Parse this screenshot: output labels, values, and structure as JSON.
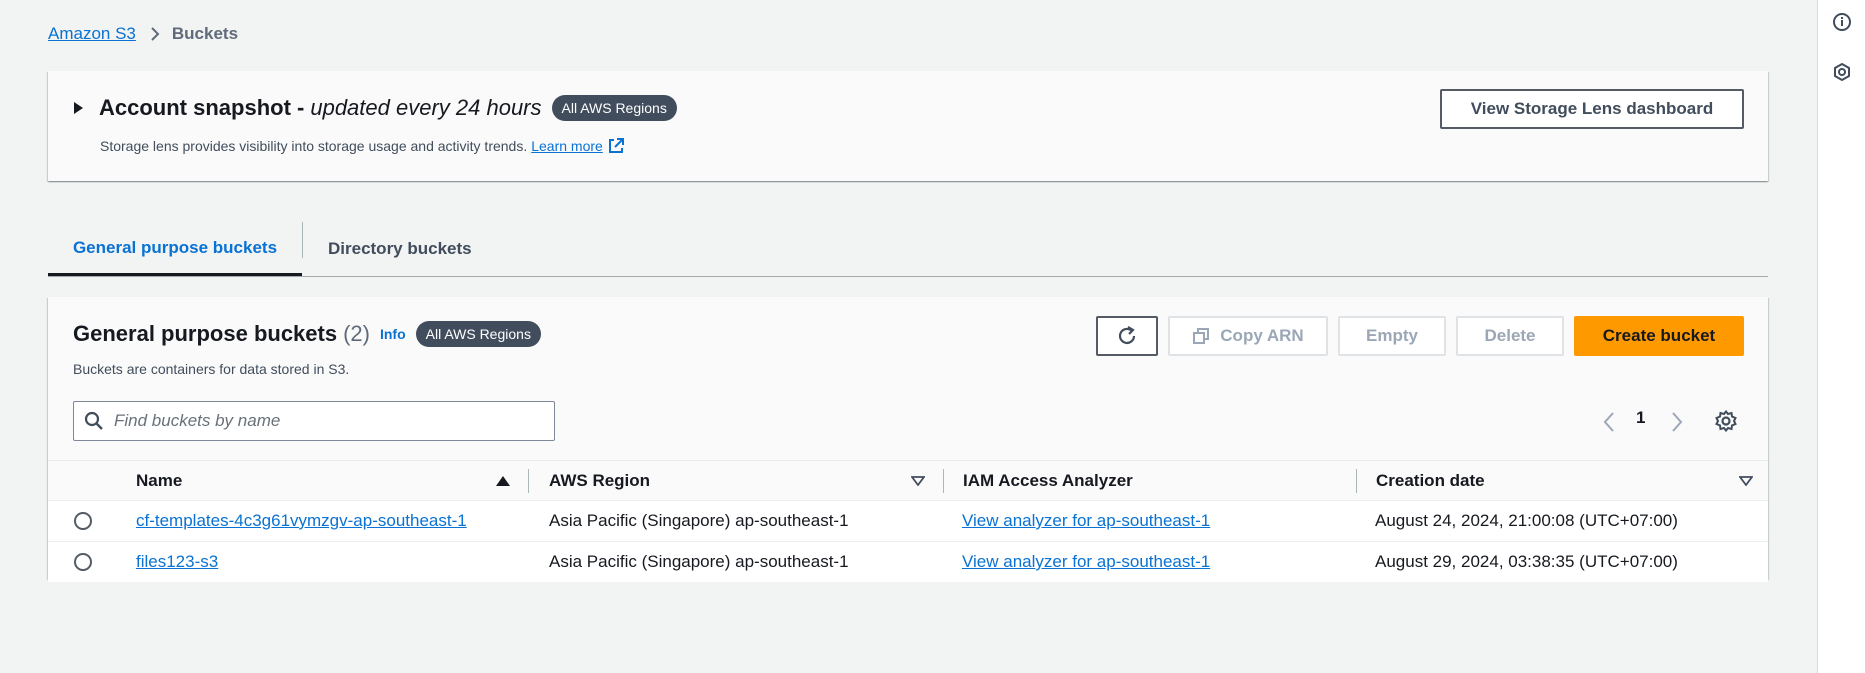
{
  "breadcrumb": {
    "root": "Amazon S3",
    "current": "Buckets"
  },
  "snapshot": {
    "title": "Account snapshot -",
    "subtitle": "updated every 24 hours",
    "badge": "All AWS Regions",
    "description": "Storage lens provides visibility into storage usage and activity trends.",
    "learn_more": "Learn more",
    "dashboard_button": "View Storage Lens dashboard"
  },
  "tabs": [
    {
      "label": "General purpose buckets",
      "active": true
    },
    {
      "label": "Directory buckets",
      "active": false
    }
  ],
  "buckets": {
    "title": "General purpose buckets",
    "count": "(2)",
    "info": "Info",
    "badge": "All AWS Regions",
    "description": "Buckets are containers for data stored in S3.",
    "search_placeholder": "Find buckets by name",
    "actions": {
      "copy_arn": "Copy ARN",
      "empty": "Empty",
      "delete": "Delete",
      "create": "Create bucket"
    },
    "page": "1",
    "columns": [
      "Name",
      "AWS Region",
      "IAM Access Analyzer",
      "Creation date"
    ],
    "rows": [
      {
        "name": "cf-templates-4c3g61vymzgv-ap-southeast-1",
        "region": "Asia Pacific (Singapore) ap-southeast-1",
        "analyzer": "View analyzer for ap-southeast-1",
        "created": "August 24, 2024, 21:00:08 (UTC+07:00)"
      },
      {
        "name": "files123-s3",
        "region": "Asia Pacific (Singapore) ap-southeast-1",
        "analyzer": "View analyzer for ap-southeast-1",
        "created": "August 29, 2024, 03:38:35 (UTC+07:00)"
      }
    ]
  },
  "colors": {
    "link": "#0972d3",
    "primary": "#ff9900",
    "badge": "#414d5c",
    "text": "#16191f"
  },
  "icons": [
    "chevron-right-icon",
    "caret-right-icon",
    "external-link-icon",
    "refresh-icon",
    "copy-icon",
    "search-icon",
    "chevron-left-icon",
    "gear-icon",
    "sort-up-icon",
    "sort-down-icon",
    "info-icon",
    "lens-icon"
  ]
}
